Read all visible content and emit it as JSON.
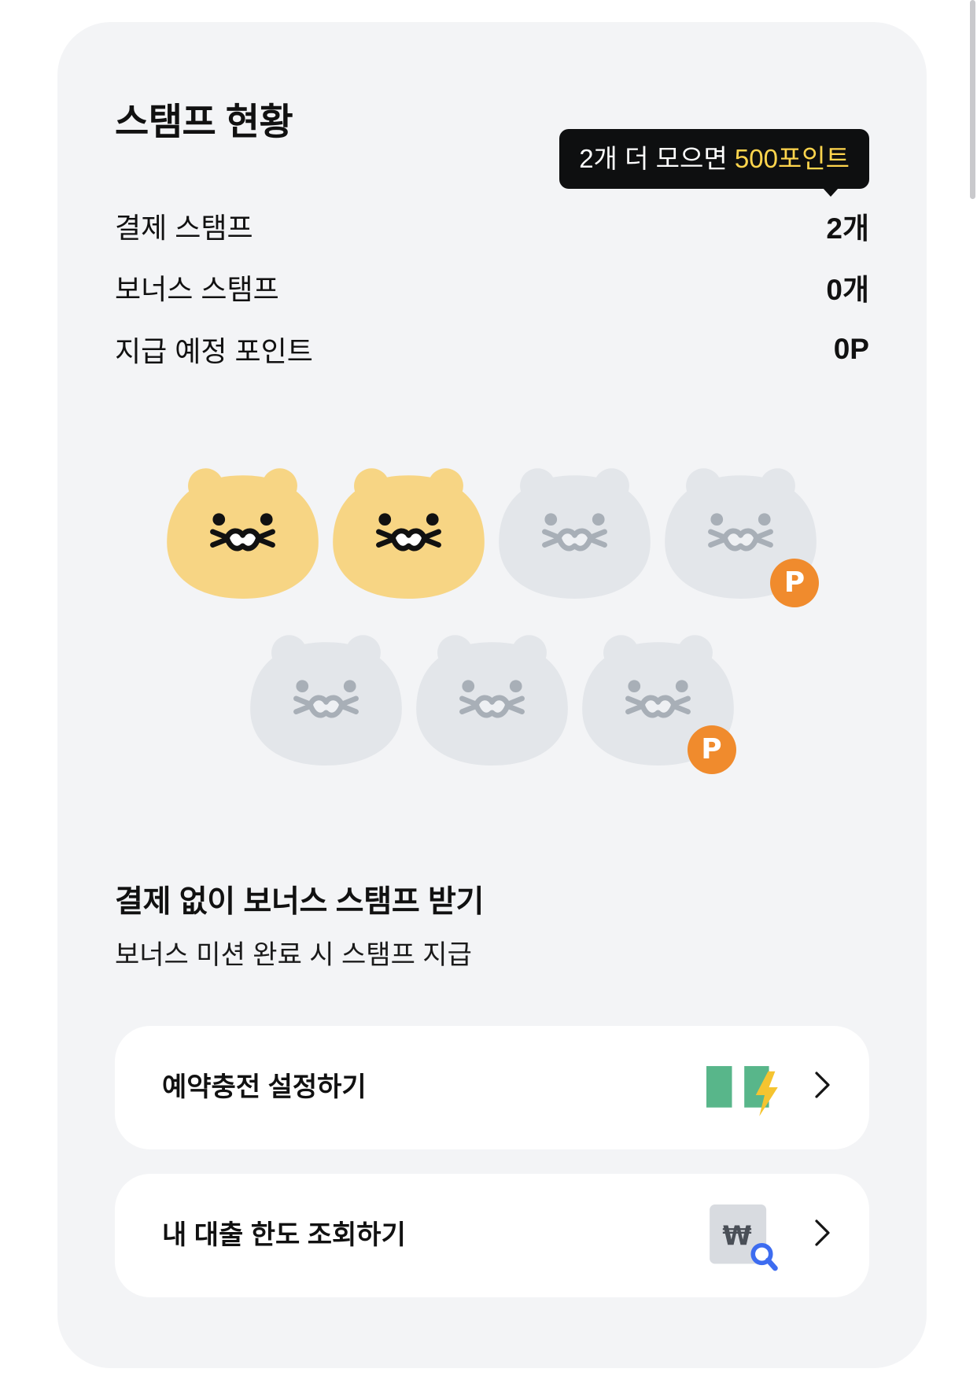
{
  "colors": {
    "page_bg": "#ffffff",
    "card_bg": "#f3f4f6",
    "text_primary": "#111111",
    "tooltip_bg": "#0e0f10",
    "tooltip_text": "#ffffff",
    "tooltip_highlight": "#ffd54d",
    "stamp_collected": "#f7d584",
    "stamp_empty": "#e3e6ea",
    "stamp_face_collected": "#111111",
    "stamp_face_empty": "#a8afb7",
    "point_badge": "#f08b2d",
    "charge_green": "#58b68a",
    "charge_bolt": "#f5c430",
    "search_blue": "#3d6cf0",
    "loan_icon_bg": "#d8dbe0"
  },
  "stamp_status": {
    "title": "스탬프 현황",
    "tooltip": {
      "prefix": "2개 더 모으면 ",
      "highlight": "500포인트"
    },
    "rows": [
      {
        "label": "결제 스탬프",
        "value": "2개"
      },
      {
        "label": "보너스 스탬프",
        "value": "0개"
      },
      {
        "label": "지급 예정 포인트",
        "value": "0P"
      }
    ],
    "board": {
      "stamps": [
        {
          "state": "collected",
          "icon": "cat-face-icon"
        },
        {
          "state": "collected",
          "icon": "cat-face-icon"
        },
        {
          "state": "empty",
          "icon": "cat-face-icon"
        },
        {
          "state": "empty",
          "icon": "cat-face-icon",
          "badge": "P"
        },
        {
          "state": "empty",
          "icon": "cat-face-icon"
        },
        {
          "state": "empty",
          "icon": "cat-face-icon"
        },
        {
          "state": "empty",
          "icon": "cat-face-icon",
          "badge": "P"
        }
      ]
    }
  },
  "bonus": {
    "heading": "결제 없이 보너스 스탬프 받기",
    "subtitle": "보너스 미션 완료 시 스탬프 지급",
    "actions": [
      {
        "label": "예약충전 설정하기",
        "icon": "battery-charge-icon",
        "chevron": "chevron-right-icon"
      },
      {
        "label": "내 대출 한도 조회하기",
        "icon": "won-search-icon",
        "icon_glyph": "₩",
        "chevron": "chevron-right-icon"
      }
    ]
  }
}
